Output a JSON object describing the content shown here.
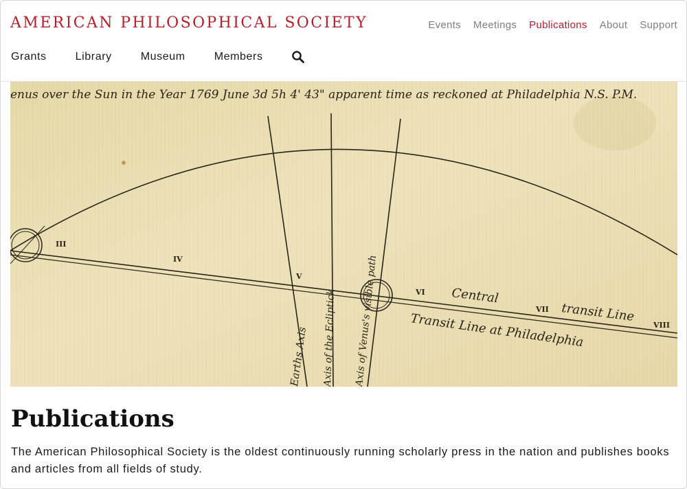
{
  "brand": {
    "logo_text": "AMERICAN PHILOSOPHICAL SOCIETY",
    "accent_color": "#b21f2d"
  },
  "utility_nav": [
    {
      "label": "Events",
      "active": false
    },
    {
      "label": "Meetings",
      "active": false
    },
    {
      "label": "Publications",
      "active": true
    },
    {
      "label": "About",
      "active": false
    },
    {
      "label": "Support",
      "active": false
    }
  ],
  "main_nav": [
    {
      "label": "Grants"
    },
    {
      "label": "Library"
    },
    {
      "label": "Museum"
    },
    {
      "label": "Members"
    }
  ],
  "search": {
    "icon": "search-icon"
  },
  "hero": {
    "caption_top": "enus over the Sun in the Year 1769 June 3d 5h 4' 43\" apparent time as reckoned at Philadelphia N.S. P.M.",
    "numerals": [
      "III",
      "IV",
      "V",
      "VI",
      "VII",
      "VIII"
    ],
    "labels": {
      "central": "Central",
      "transit_line": "transit Line",
      "transit_philadelphia": "Transit Line at Philadelphia",
      "earths_axis": "Earths Axis",
      "ecliptic": "Axis of the Ecliptick",
      "venus_path": "Axis of Venus's visible path"
    }
  },
  "page": {
    "title": "Publications",
    "intro": "The American Philosophical Society is the oldest continuously running scholarly press in the nation and publishes books and articles from all fields of study."
  }
}
